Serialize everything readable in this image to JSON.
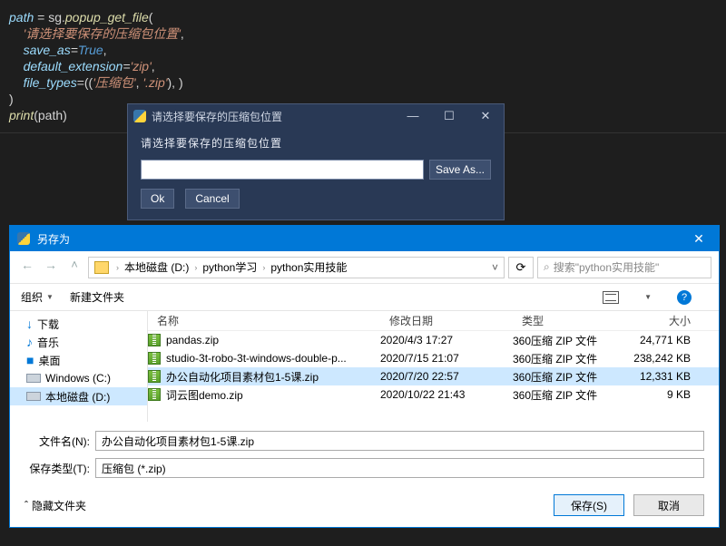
{
  "code": {
    "l1a": "path",
    "l1b": " = sg.",
    "l1c": "popup_get_file",
    "l1d": "(",
    "l2": "'请选择要保存的压缩包位置'",
    "l2c": ",",
    "l3a": "save_as",
    "l3b": "=",
    "l3c": "True",
    "l3d": ",",
    "l4a": "default_extension",
    "l4b": "=",
    "l4c": "'zip'",
    "l4d": ",",
    "l5a": "file_types",
    "l5b": "=((",
    "l5c": "'压缩包'",
    "l5d": ", ",
    "l5e": "'.zip'",
    "l5f": "), )",
    "l6": ")",
    "l7a": "print",
    "l7b": "(path)"
  },
  "popup": {
    "title": "请选择要保存的压缩包位置",
    "label": "请选择要保存的压缩包位置",
    "saveas": "Save As...",
    "ok": "Ok",
    "cancel": "Cancel",
    "min": "—",
    "max": "☐",
    "close": "✕"
  },
  "save": {
    "title": "另存为",
    "close": "✕",
    "crumbs": [
      "本地磁盘 (D:)",
      "python学习",
      "python实用技能"
    ],
    "refresh": "⟳",
    "search_ph": "搜索\"python实用技能\"",
    "org": "组织",
    "org_dd": "▼",
    "newf": "新建文件夹",
    "tree": [
      {
        "icon": "↓",
        "label": "下载"
      },
      {
        "icon": "♪",
        "label": "音乐"
      },
      {
        "icon": "■",
        "label": "桌面"
      },
      {
        "icon": "disk",
        "label": "Windows (C:)"
      },
      {
        "icon": "disk",
        "label": "本地磁盘 (D:)",
        "sel": true
      }
    ],
    "cols": {
      "name": "名称",
      "date": "修改日期",
      "type": "类型",
      "size": "大小"
    },
    "rows": [
      {
        "name": "pandas.zip",
        "date": "2020/4/3 17:27",
        "type": "360压缩 ZIP 文件",
        "size": "24,771 KB"
      },
      {
        "name": "studio-3t-robo-3t-windows-double-p...",
        "date": "2020/7/15 21:07",
        "type": "360压缩 ZIP 文件",
        "size": "238,242 KB"
      },
      {
        "name": "办公自动化项目素材包1-5课.zip",
        "date": "2020/7/20 22:57",
        "type": "360压缩 ZIP 文件",
        "size": "12,331 KB",
        "sel": true
      },
      {
        "name": "词云图demo.zip",
        "date": "2020/10/22 21:43",
        "type": "360压缩 ZIP 文件",
        "size": "9 KB"
      }
    ],
    "fn_label": "文件名(N):",
    "fn_value": "办公自动化项目素材包1-5课.zip",
    "ft_label": "保存类型(T):",
    "ft_value": "压缩包 (*.zip)",
    "hide": "隐藏文件夹",
    "hide_caret": "ˆ",
    "savebtn": "保存(S)",
    "cancelbtn": "取消"
  }
}
